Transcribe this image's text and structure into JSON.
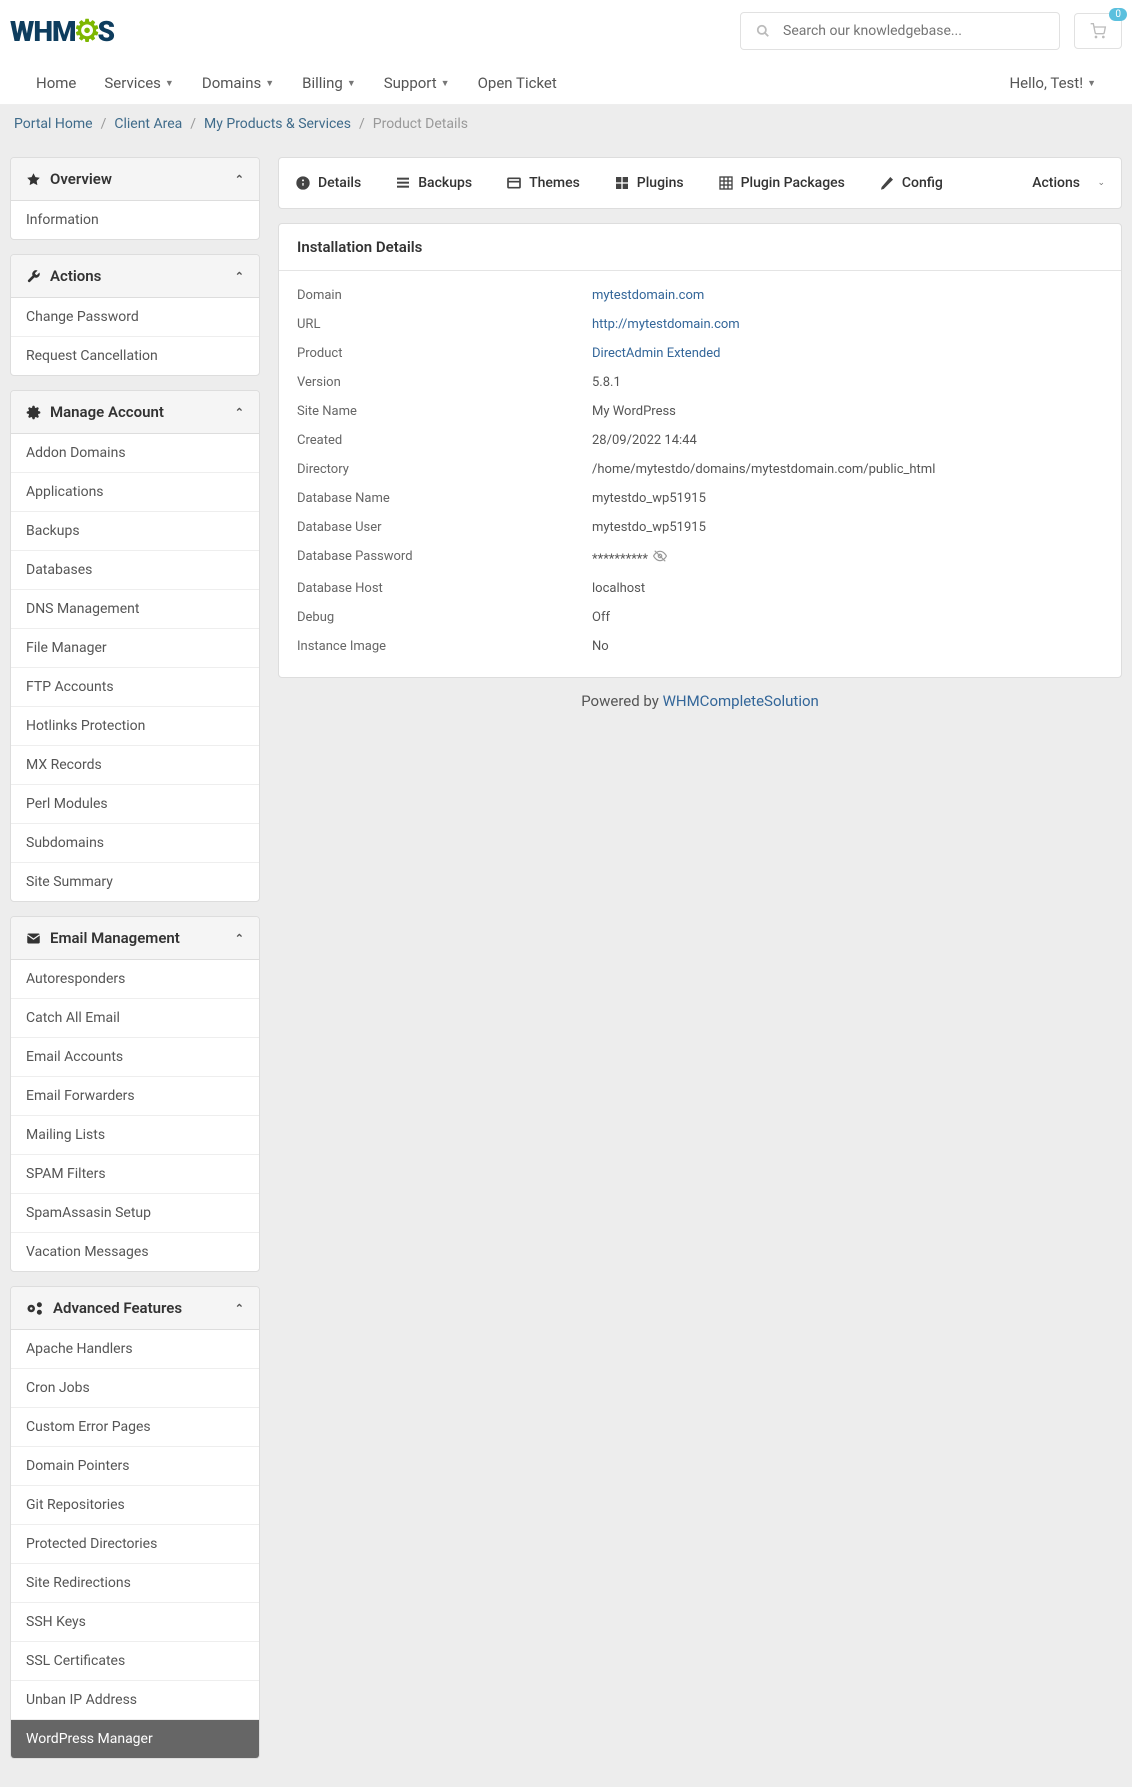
{
  "header": {
    "search_placeholder": "Search our knowledgebase...",
    "cart_count": "0"
  },
  "nav": {
    "items": [
      "Home",
      "Services",
      "Domains",
      "Billing",
      "Support",
      "Open Ticket"
    ],
    "dropdowns": [
      false,
      true,
      true,
      true,
      true,
      false
    ],
    "user_greeting": "Hello, Test!"
  },
  "breadcrumb": {
    "items": [
      "Portal Home",
      "Client Area",
      "My Products & Services"
    ],
    "current": "Product Details"
  },
  "sidebar": {
    "panels": [
      {
        "title": "Overview",
        "icon": "star",
        "items": [
          "Information"
        ]
      },
      {
        "title": "Actions",
        "icon": "wrench",
        "items": [
          "Change Password",
          "Request Cancellation"
        ]
      },
      {
        "title": "Manage Account",
        "icon": "cog",
        "items": [
          "Addon Domains",
          "Applications",
          "Backups",
          "Databases",
          "DNS Management",
          "File Manager",
          "FTP Accounts",
          "Hotlinks Protection",
          "MX Records",
          "Perl Modules",
          "Subdomains",
          "Site Summary"
        ]
      },
      {
        "title": "Email Management",
        "icon": "envelope",
        "items": [
          "Autoresponders",
          "Catch All Email",
          "Email Accounts",
          "Email Forwarders",
          "Mailing Lists",
          "SPAM Filters",
          "SpamAssasin Setup",
          "Vacation Messages"
        ]
      },
      {
        "title": "Advanced Features",
        "icon": "cogs",
        "items": [
          "Apache Handlers",
          "Cron Jobs",
          "Custom Error Pages",
          "Domain Pointers",
          "Git Repositories",
          "Protected Directories",
          "Site Redirections",
          "SSH Keys",
          "SSL Certificates",
          "Unban IP Address",
          "WordPress Manager"
        ]
      }
    ],
    "active": "WordPress Manager"
  },
  "tabs": {
    "items": [
      {
        "label": "Details",
        "icon": "info"
      },
      {
        "label": "Backups",
        "icon": "list"
      },
      {
        "label": "Themes",
        "icon": "window"
      },
      {
        "label": "Plugins",
        "icon": "puzzle"
      },
      {
        "label": "Plugin Packages",
        "icon": "grid"
      },
      {
        "label": "Config",
        "icon": "pencil"
      }
    ],
    "actions_label": "Actions"
  },
  "details": {
    "title": "Installation Details",
    "rows": [
      {
        "label": "Domain",
        "value": "mytestdomain.com",
        "link": true
      },
      {
        "label": "URL",
        "value": "http://mytestdomain.com",
        "link": true
      },
      {
        "label": "Product",
        "value": "DirectAdmin Extended",
        "link": true
      },
      {
        "label": "Version",
        "value": "5.8.1"
      },
      {
        "label": "Site Name",
        "value": "My WordPress"
      },
      {
        "label": "Created",
        "value": "28/09/2022 14:44"
      },
      {
        "label": "Directory",
        "value": "/home/mytestdo/domains/mytestdomain.com/public_html"
      },
      {
        "label": "Database Name",
        "value": "mytestdo_wp51915"
      },
      {
        "label": "Database User",
        "value": "mytestdo_wp51915"
      },
      {
        "label": "Database Password",
        "value": "**********",
        "eye": true
      },
      {
        "label": "Database Host",
        "value": "localhost"
      },
      {
        "label": "Debug",
        "value": "Off"
      },
      {
        "label": "Instance Image",
        "value": "No"
      }
    ]
  },
  "footer": {
    "text": "Powered by ",
    "link": "WHMCompleteSolution"
  }
}
